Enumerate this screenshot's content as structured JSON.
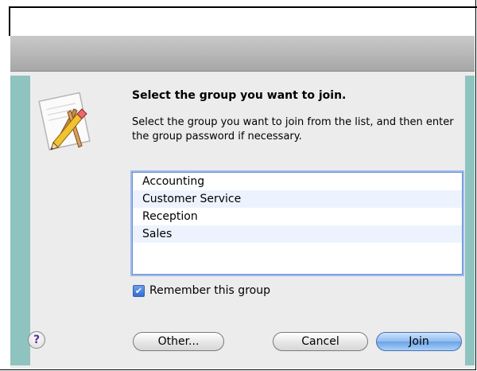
{
  "dialog": {
    "heading": "Select the group you want to join.",
    "description": "Select the group you want to join from the list, and then enter the group password if necessary.",
    "groups": [
      "Accounting",
      "Customer Service",
      "Reception",
      "Sales",
      ""
    ],
    "remember_checked": true,
    "remember_label": "Remember this group",
    "buttons": {
      "help": "?",
      "other": "Other...",
      "cancel": "Cancel",
      "join": "Join"
    }
  },
  "icons": {
    "app": "text-edit-pencil-icon",
    "help": "help-question-icon",
    "check": "checkmark-icon"
  },
  "colors": {
    "accent_strip": "#8fc3bf",
    "selection_blue": "#9dbbf0",
    "default_button": "#6aa3e6"
  }
}
